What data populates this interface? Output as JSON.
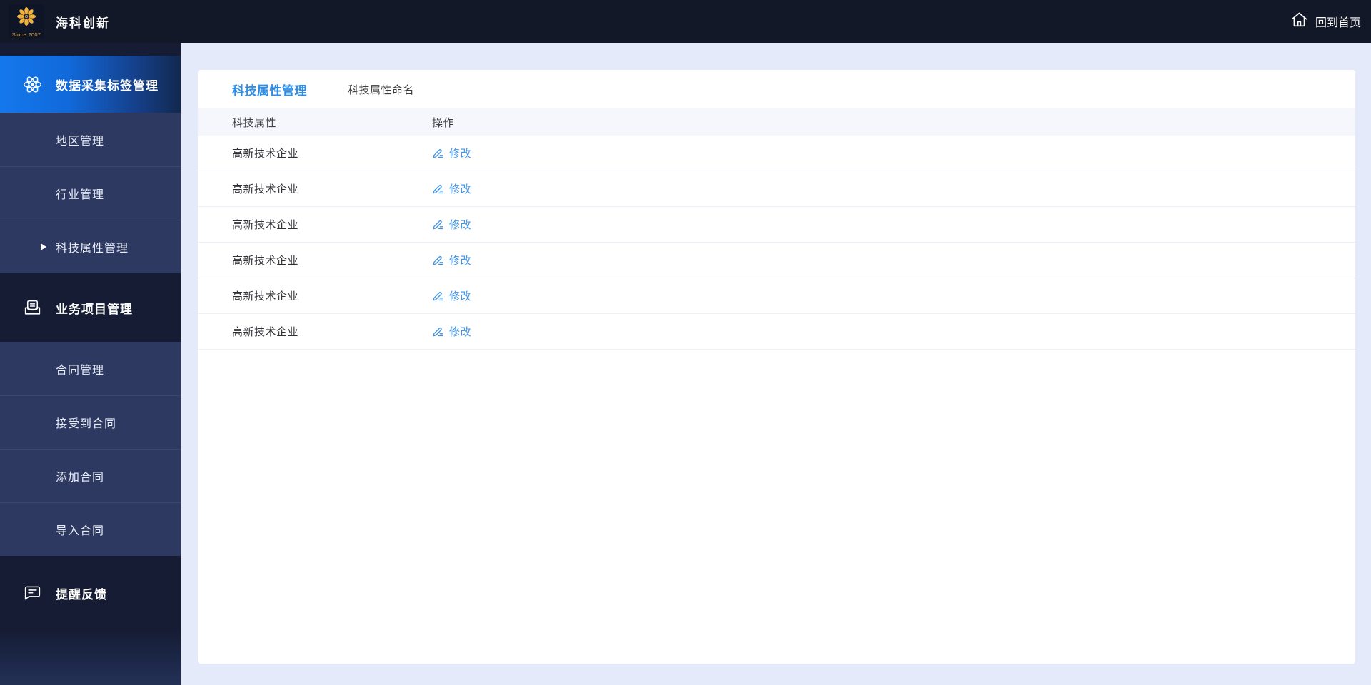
{
  "topbar": {
    "brand_title": "海科创新",
    "logo_since": "Since 2007",
    "home_link": "回到首页"
  },
  "sidebar": {
    "sections": [
      {
        "label": "数据采集标签管理",
        "icon": "atom-icon",
        "active": true,
        "children": [
          "地区管理",
          "行业管理",
          "科技属性管理"
        ]
      },
      {
        "label": "业务项目管理",
        "icon": "book-tray-icon",
        "children": [
          "合同管理",
          "接受到合同",
          "添加合同",
          "导入合同"
        ]
      },
      {
        "label": "提醒反馈",
        "icon": "chat-bubble-icon",
        "children": []
      }
    ]
  },
  "tabs": [
    {
      "label": "科技属性管理",
      "active": true
    },
    {
      "label": "科技属性命名",
      "active": false
    }
  ],
  "table": {
    "columns": [
      "科技属性",
      "操作"
    ],
    "rows": [
      {
        "attribute": "高新技术企业",
        "action": "修改"
      },
      {
        "attribute": "高新技术企业",
        "action": "修改"
      },
      {
        "attribute": "高新技术企业",
        "action": "修改"
      },
      {
        "attribute": "高新技术企业",
        "action": "修改"
      },
      {
        "attribute": "高新技术企业",
        "action": "修改"
      },
      {
        "attribute": "高新技术企业",
        "action": "修改"
      }
    ]
  },
  "colors": {
    "topbar_bg": "#121827",
    "sidebar_group_bg": "#161c33",
    "sidebar_submenu_bg": "#2d3961",
    "active_item_gradient_start": "#1478ec",
    "active_item_gradient_end": "#12294f",
    "main_bg": "#e5eafa",
    "table_header_bg": "#f5f7fd",
    "active_tab_text": "#2f8de4",
    "link_blue": "#4094e8",
    "logo_gold": "#f2b13e"
  }
}
